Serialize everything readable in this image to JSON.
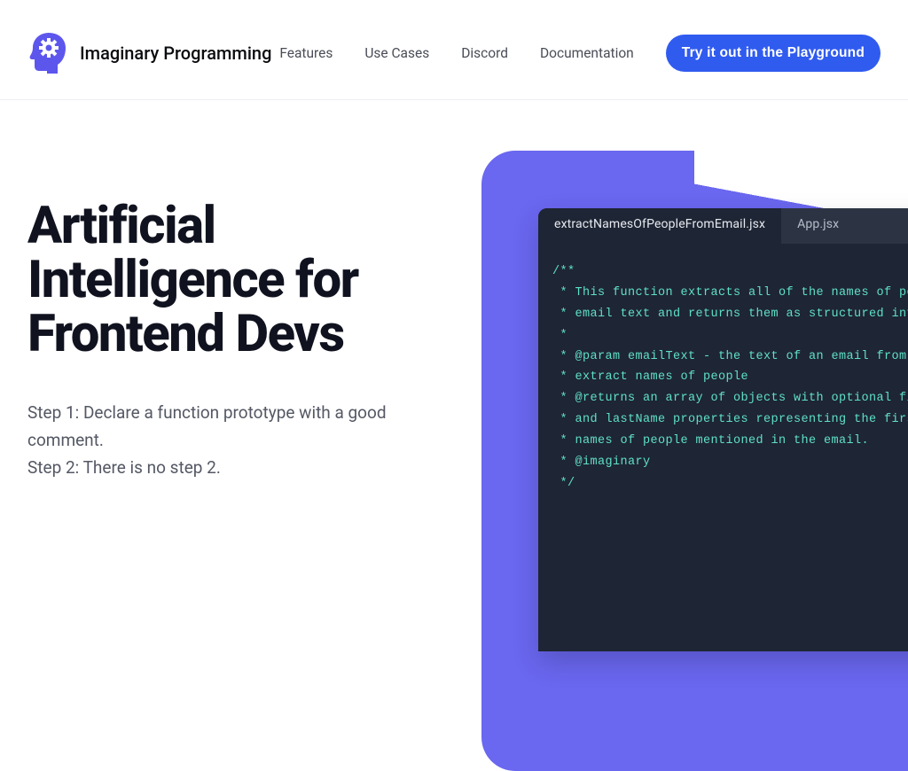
{
  "header": {
    "brand": "Imaginary Programming",
    "nav": {
      "features": "Features",
      "useCases": "Use Cases",
      "discord": "Discord",
      "documentation": "Documentation"
    },
    "cta": "Try it out in the Playground"
  },
  "hero": {
    "headline": "Artificial Intelligence for Frontend Devs",
    "step1": "Step 1: Declare a function prototype with a good comment.",
    "step2": "Step 2: There is no step 2."
  },
  "editor": {
    "tabs": {
      "active": "extractNamesOfPeopleFromEmail.jsx",
      "inactive": "App.jsx"
    },
    "code": "/**\n * This function extracts all of the names of people\n * email text and returns them as structured informa\n *\n * @param emailText - the text of an email from whic\n * extract names of people\n * @returns an array of objects with optional firstN\n * and lastName properties representing the first an\n * names of people mentioned in the email.\n * @imaginary\n */"
  }
}
